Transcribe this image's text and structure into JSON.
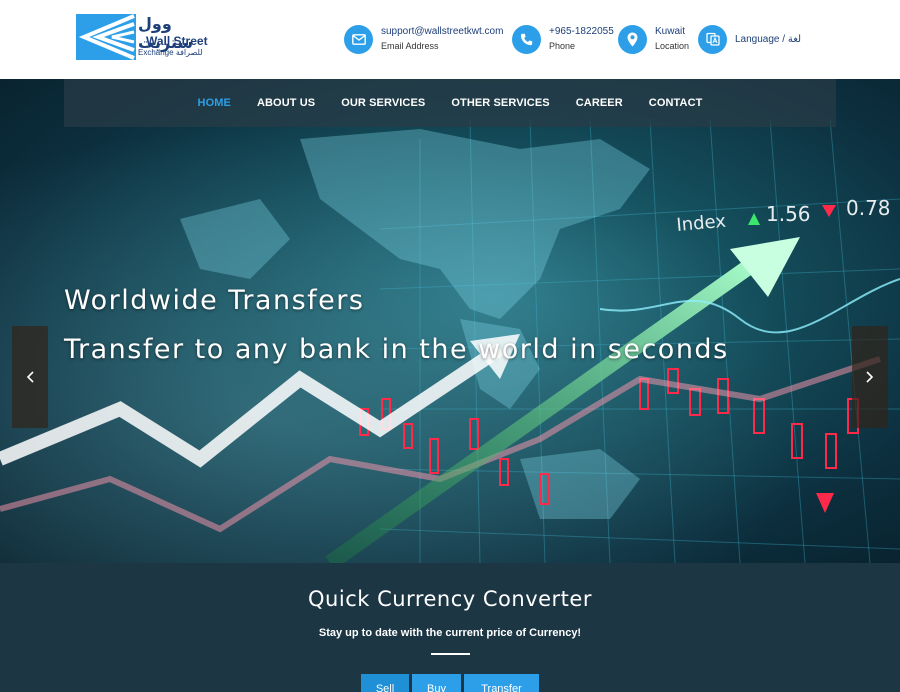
{
  "header": {
    "logo": {
      "arabic": "وول ستريت",
      "english": "Wall Street",
      "subtitle": "Exchange للصرافة"
    },
    "contact": [
      {
        "main": "support@wallstreetkwt.com",
        "sub": "Email Address",
        "icon": "envelope-icon"
      },
      {
        "main": "+965-1822055",
        "sub": "Phone",
        "icon": "phone-icon"
      },
      {
        "main": "Kuwait",
        "sub": "Location",
        "icon": "map-pin-icon"
      }
    ],
    "language": {
      "label": "Language / لغة",
      "icon": "language-icon"
    }
  },
  "nav": {
    "items": [
      {
        "label": "HOME",
        "active": true
      },
      {
        "label": "ABOUT US"
      },
      {
        "label": "OUR SERVICES"
      },
      {
        "label": "OTHER SERVICES"
      },
      {
        "label": "CAREER"
      },
      {
        "label": "CONTACT"
      }
    ]
  },
  "hero": {
    "headline": "Worldwide Transfers",
    "subheadline": "Transfer to any bank in the world in seconds",
    "ticker": {
      "label": "Index",
      "up_value": "1.56",
      "down_value": "0.78"
    }
  },
  "converter": {
    "title": "Quick Currency Converter",
    "subtitle": "Stay up to date with the current price of Currency!",
    "tabs": [
      "Sell",
      "Buy",
      "Transfer"
    ]
  },
  "colors": {
    "accent": "#2c9fe8",
    "navy": "#1d3f7a",
    "converter_bg": "#1c3644"
  }
}
